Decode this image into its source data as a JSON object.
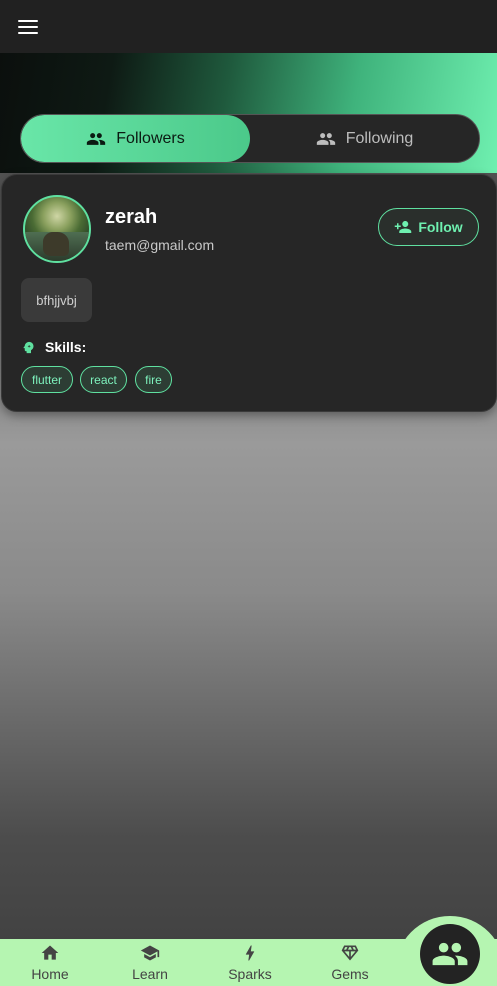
{
  "appbar": {
    "menu_icon": "menu-icon"
  },
  "tabs": [
    {
      "label": "Followers",
      "icon": "group-icon",
      "active": true
    },
    {
      "label": "Following",
      "icon": "group-icon",
      "active": false
    }
  ],
  "profile": {
    "name": "zerah",
    "email": "taem@gmail.com",
    "follow_label": "Follow",
    "bio": "bfhjjvbj",
    "skills_label": "Skills:",
    "skills": [
      "flutter",
      "react",
      "fire"
    ]
  },
  "nav": {
    "items": [
      {
        "label": "Home",
        "icon": "home-icon"
      },
      {
        "label": "Learn",
        "icon": "school-icon"
      },
      {
        "label": "Sparks",
        "icon": "bolt-icon"
      },
      {
        "label": "Gems",
        "icon": "diamond-icon"
      }
    ],
    "fab_icon": "people-icon"
  },
  "colors": {
    "accent": "#5fe0a0",
    "navbar": "#b5f5b1",
    "card": "#262626",
    "appbar": "#212121"
  }
}
